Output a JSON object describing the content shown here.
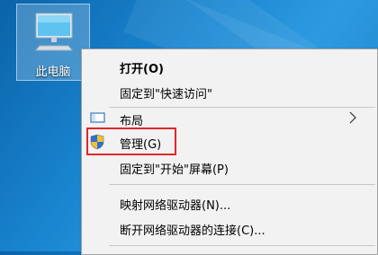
{
  "desktop": {
    "icon_label": "此电脑"
  },
  "context_menu": {
    "items": [
      {
        "label": "打开(O)"
      },
      {
        "label": "固定到\"快速访问\""
      },
      {
        "label": "布局",
        "icon": "layout-icon",
        "has_submenu": true
      },
      {
        "label": "管理(G)",
        "icon": "uac-shield-icon",
        "highlighted": true
      },
      {
        "label": "固定到\"开始\"屏幕(P)"
      },
      {
        "label": "映射网络驱动器(N)..."
      },
      {
        "label": "断开网络驱动器的连接(C)..."
      }
    ]
  },
  "colors": {
    "highlight_border": "#e2262b",
    "desktop_bg": "#1a86d1",
    "menu_bg": "#f2f2f2"
  }
}
